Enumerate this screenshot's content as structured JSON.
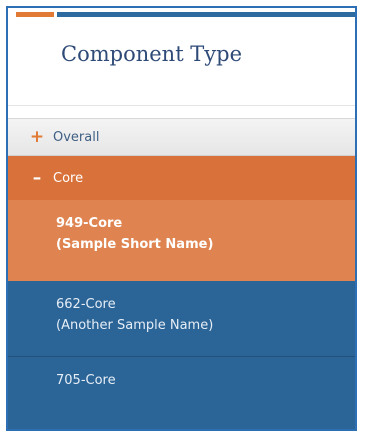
{
  "panel": {
    "title": "Component Type"
  },
  "tree": {
    "overall": {
      "toggle_icon": "plus-icon",
      "toggle_glyph": "+",
      "label": "Overall",
      "expanded": false
    },
    "core": {
      "toggle_icon": "minus-icon",
      "toggle_glyph": "–",
      "label": "Core",
      "expanded": true,
      "items": [
        {
          "line1": "949-Core",
          "line2": "(Sample Short Name)",
          "selected": true
        },
        {
          "line1": "662-Core",
          "line2": "(Another Sample Name)",
          "selected": false
        },
        {
          "line1": "705-Core",
          "line2": "",
          "selected": false
        }
      ]
    }
  },
  "colors": {
    "accent_orange": "#e07a35",
    "accent_blue": "#2d6aa0",
    "title_navy": "#2e4a77",
    "selected_item": "#df8450",
    "group_header": "#d9723a",
    "item_blue": "#2b6496"
  }
}
